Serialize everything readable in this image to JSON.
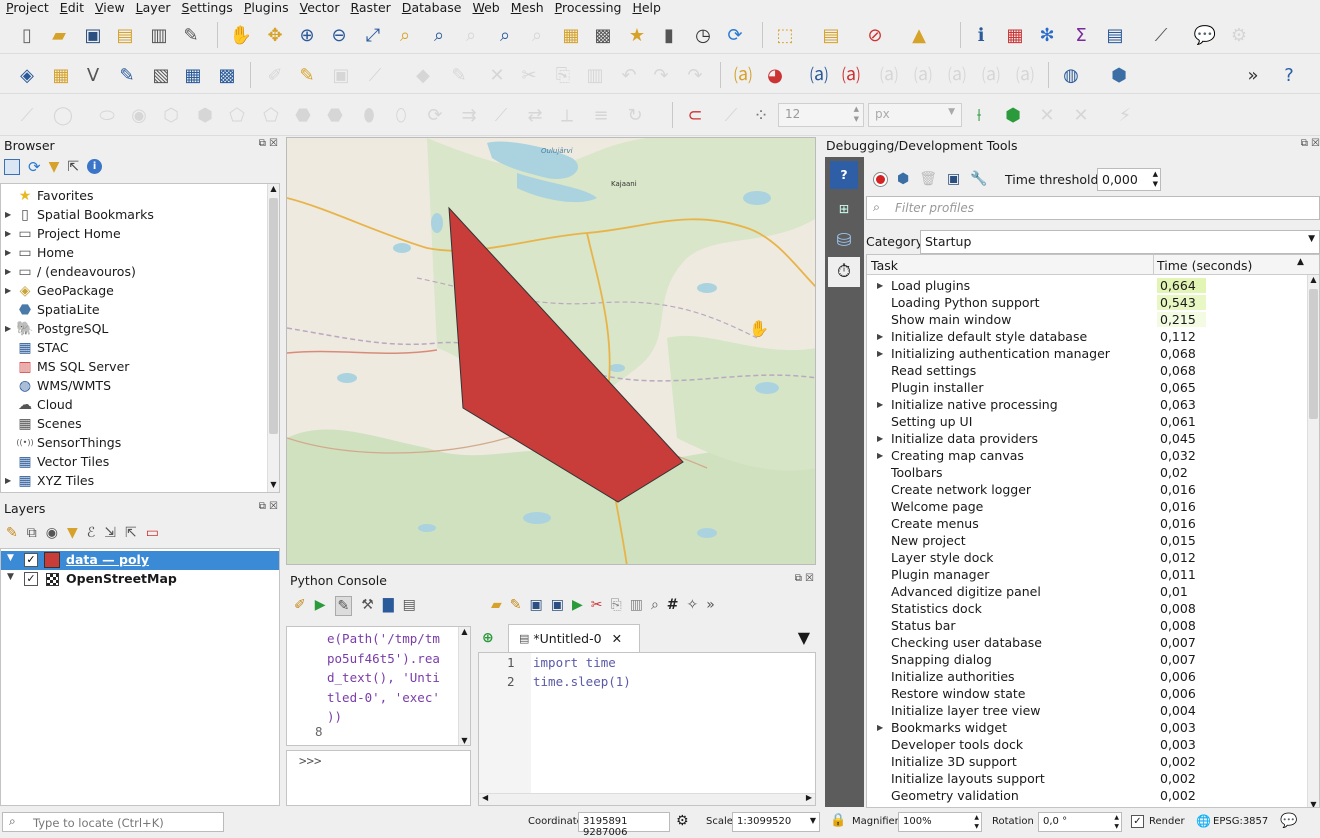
{
  "menu": [
    "Project",
    "Edit",
    "View",
    "Layer",
    "Settings",
    "Plugins",
    "Vector",
    "Raster",
    "Database",
    "Web",
    "Mesh",
    "Processing",
    "Help"
  ],
  "browser": {
    "title": "Browser",
    "items": [
      {
        "label": "Favorites",
        "icon": "star-icon",
        "arrow": ""
      },
      {
        "label": "Spatial Bookmarks",
        "icon": "bookmark-icon",
        "arrow": "▶"
      },
      {
        "label": "Project Home",
        "icon": "folder-icon",
        "arrow": "▶"
      },
      {
        "label": "Home",
        "icon": "folder-icon",
        "arrow": "▶"
      },
      {
        "label": "/ (endeavouros)",
        "icon": "folder-icon",
        "arrow": "▶"
      },
      {
        "label": "GeoPackage",
        "icon": "geopackage-icon",
        "arrow": "▶"
      },
      {
        "label": "SpatiaLite",
        "icon": "spatialite-icon",
        "arrow": ""
      },
      {
        "label": "PostgreSQL",
        "icon": "postgresql-icon",
        "arrow": "▶"
      },
      {
        "label": "STAC",
        "icon": "stac-icon",
        "arrow": ""
      },
      {
        "label": "MS SQL Server",
        "icon": "mssql-icon",
        "arrow": ""
      },
      {
        "label": "WMS/WMTS",
        "icon": "globe-icon",
        "arrow": ""
      },
      {
        "label": "Cloud",
        "icon": "cloud-icon",
        "arrow": ""
      },
      {
        "label": "Scenes",
        "icon": "scenes-icon",
        "arrow": ""
      },
      {
        "label": "SensorThings",
        "icon": "sensor-icon",
        "arrow": ""
      },
      {
        "label": "Vector Tiles",
        "icon": "grid-icon",
        "arrow": ""
      },
      {
        "label": "XYZ Tiles",
        "icon": "grid-icon",
        "arrow": "▶"
      }
    ]
  },
  "layers": {
    "title": "Layers",
    "items": [
      {
        "label": "data — poly",
        "color": "#c83c3a",
        "selected": true
      },
      {
        "label": "OpenStreetMap",
        "color": "",
        "selected": false
      }
    ]
  },
  "map": {
    "labels": {
      "city": "Kajaani",
      "lake": "Oulujärvi"
    },
    "polygon_color": "#c83c3a"
  },
  "python_console": {
    "title": "Python Console",
    "output_lines": [
      "e(Path('/tmp/tm",
      "po5uf46t5').rea",
      "d_text(), 'Unti",
      "tled-0', 'exec'",
      "))"
    ],
    "line_number": "8",
    "prompt": ">>>",
    "editor_tab": "*Untitled-0",
    "code_lines": [
      {
        "num": "1",
        "text": "import time"
      },
      {
        "num": "2",
        "text": "time.sleep(1)"
      }
    ]
  },
  "devtools": {
    "title": "Debugging/Development Tools",
    "time_threshold_label": "Time threshold",
    "time_threshold_value": "0,000",
    "filter_placeholder": "Filter profiles",
    "category_label": "Category",
    "category_value": "Startup",
    "col_task": "Task",
    "col_time": "Time (seconds)",
    "rows": [
      {
        "task": "Load plugins",
        "time": "0,664",
        "arrow": true,
        "hl": "#e2f5b4"
      },
      {
        "task": "Loading Python support",
        "time": "0,543",
        "arrow": false,
        "hl": "#e8f7c4"
      },
      {
        "task": "Show main window",
        "time": "0,215",
        "arrow": false,
        "hl": "#f3fbe3"
      },
      {
        "task": "Initialize default style database",
        "time": "0,112",
        "arrow": true,
        "hl": ""
      },
      {
        "task": "Initializing authentication manager",
        "time": "0,068",
        "arrow": true,
        "hl": ""
      },
      {
        "task": "Read settings",
        "time": "0,068",
        "arrow": false,
        "hl": ""
      },
      {
        "task": "Plugin installer",
        "time": "0,065",
        "arrow": false,
        "hl": ""
      },
      {
        "task": "Initialize native processing",
        "time": "0,063",
        "arrow": true,
        "hl": ""
      },
      {
        "task": "Setting up UI",
        "time": "0,061",
        "arrow": false,
        "hl": ""
      },
      {
        "task": "Initialize data providers",
        "time": "0,045",
        "arrow": true,
        "hl": ""
      },
      {
        "task": "Creating map canvas",
        "time": "0,032",
        "arrow": true,
        "hl": ""
      },
      {
        "task": "Toolbars",
        "time": "0,02",
        "arrow": false,
        "hl": ""
      },
      {
        "task": "Create network logger",
        "time": "0,016",
        "arrow": false,
        "hl": ""
      },
      {
        "task": "Welcome page",
        "time": "0,016",
        "arrow": false,
        "hl": ""
      },
      {
        "task": "Create menus",
        "time": "0,016",
        "arrow": false,
        "hl": ""
      },
      {
        "task": "New project",
        "time": "0,015",
        "arrow": false,
        "hl": ""
      },
      {
        "task": "Layer style dock",
        "time": "0,012",
        "arrow": false,
        "hl": ""
      },
      {
        "task": "Plugin manager",
        "time": "0,011",
        "arrow": false,
        "hl": ""
      },
      {
        "task": "Advanced digitize panel",
        "time": "0,01",
        "arrow": false,
        "hl": ""
      },
      {
        "task": "Statistics dock",
        "time": "0,008",
        "arrow": false,
        "hl": ""
      },
      {
        "task": "Status bar",
        "time": "0,008",
        "arrow": false,
        "hl": ""
      },
      {
        "task": "Checking user database",
        "time": "0,007",
        "arrow": false,
        "hl": ""
      },
      {
        "task": "Snapping dialog",
        "time": "0,007",
        "arrow": false,
        "hl": ""
      },
      {
        "task": "Initialize authorities",
        "time": "0,006",
        "arrow": false,
        "hl": ""
      },
      {
        "task": "Restore window state",
        "time": "0,006",
        "arrow": false,
        "hl": ""
      },
      {
        "task": "Initialize layer tree view",
        "time": "0,004",
        "arrow": false,
        "hl": ""
      },
      {
        "task": "Bookmarks widget",
        "time": "0,003",
        "arrow": true,
        "hl": ""
      },
      {
        "task": "Developer tools dock",
        "time": "0,003",
        "arrow": false,
        "hl": ""
      },
      {
        "task": "Initialize 3D support",
        "time": "0,002",
        "arrow": false,
        "hl": ""
      },
      {
        "task": "Initialize layouts support",
        "time": "0,002",
        "arrow": false,
        "hl": ""
      },
      {
        "task": "Geometry validation",
        "time": "0,002",
        "arrow": false,
        "hl": ""
      }
    ]
  },
  "snapping": {
    "tolerance": "12",
    "unit": "px"
  },
  "status": {
    "locate_placeholder": "Type to locate (Ctrl+K)",
    "coordinate_label": "Coordinate",
    "coordinate_value": "3195891  9287006",
    "scale_label": "Scale",
    "scale_value": "1:3099520",
    "magnifier_label": "Magnifier",
    "magnifier_value": "100%",
    "rotation_label": "Rotation",
    "rotation_value": "0,0 °",
    "render_label": "Render",
    "crs": "EPSG:3857"
  }
}
